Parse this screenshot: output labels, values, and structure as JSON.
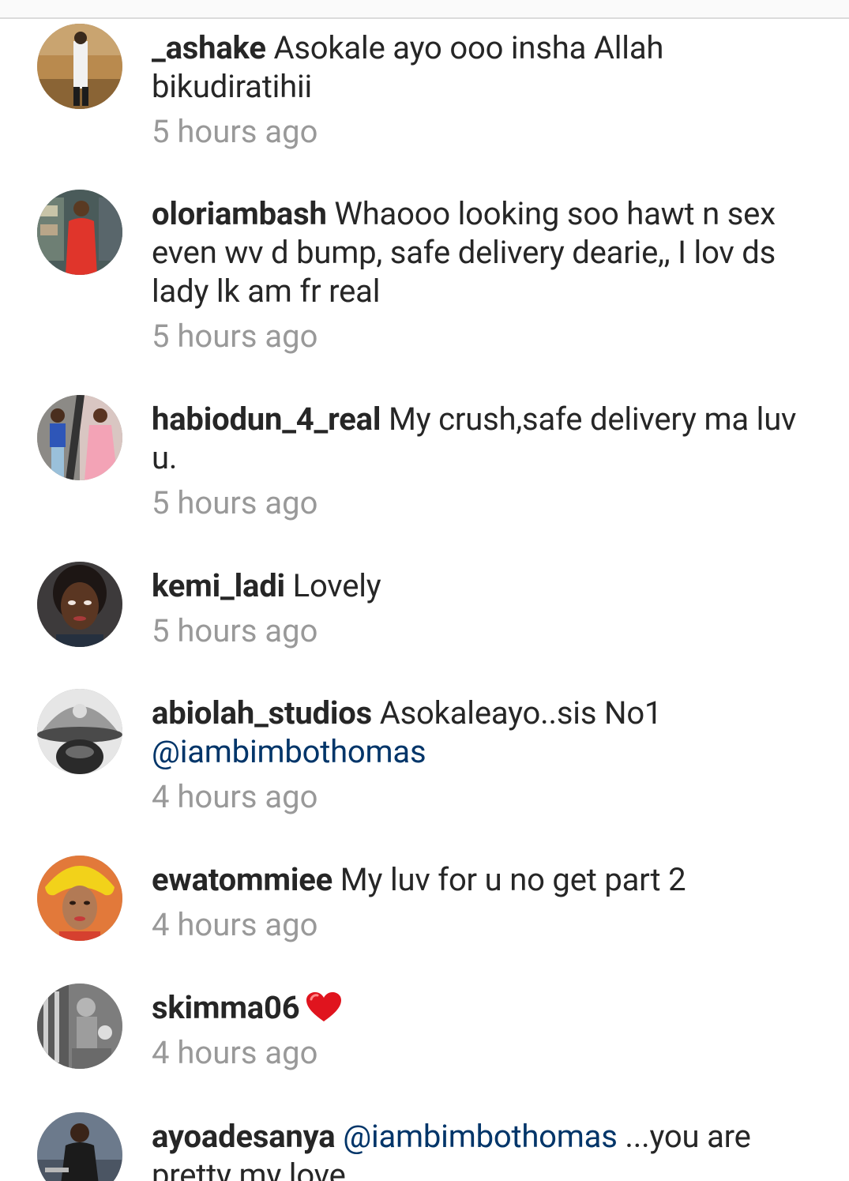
{
  "comments": [
    {
      "username": "_ashake",
      "text": "Asokale ayo ooo insha Allah bikudiratihii",
      "time": "5 hours ago"
    },
    {
      "username": "oloriambash",
      "text": "Whaooo looking soo hawt n sex even wv d bump, safe delivery dearie,, I lov ds lady lk am fr real",
      "time": "5 hours ago"
    },
    {
      "username": "habiodun_4_real",
      "text": "My crush,safe delivery ma luv u.",
      "time": "5 hours ago"
    },
    {
      "username": "kemi_ladi",
      "text": "Lovely",
      "time": "5 hours ago"
    },
    {
      "username": "abiolah_studios",
      "text": "Asokaleayo..sis No1",
      "mention": "@iambimbothomas",
      "time": "4 hours ago"
    },
    {
      "username": "ewatommiee",
      "text": "My luv for u no get part 2",
      "time": "4 hours ago"
    },
    {
      "username": "skimma06",
      "icon": "heart-icon",
      "time": "4 hours ago"
    },
    {
      "username": "ayoadesanya",
      "mention": "@iambimbothomas",
      "text": "...you are pretty my love"
    }
  ],
  "colors": {
    "text": "#262626",
    "mention": "#003569",
    "timestamp": "#999999",
    "heart": "#e0141e"
  }
}
